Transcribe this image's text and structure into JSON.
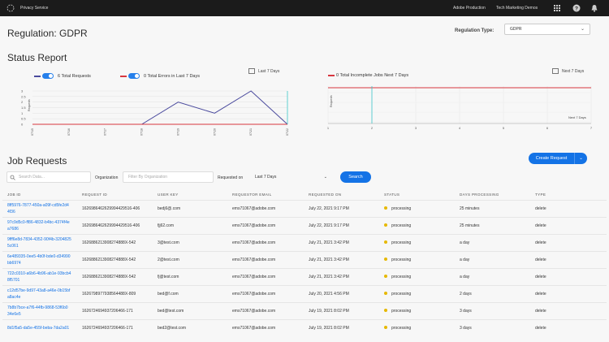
{
  "topbar": {
    "app_name": "Privacy Service",
    "org": "Adobe Production",
    "org_detail": "Tech Marketing Demos"
  },
  "header": {
    "title": "Regulation: GDPR",
    "regulation_label": "Regulation Type:",
    "regulation_value": "GDPR"
  },
  "status": {
    "title": "Status Report",
    "legend_requests": "6 Total Requests",
    "legend_errors": "0 Total Errors in Last 7 Days",
    "last7_label": "Last 7 Days",
    "incomplete_label": "0 Total Incomplete Jobs Next 7 Days",
    "next7_label": "Next 7 Days",
    "next7_axis_note": "Next 7 Days"
  },
  "chart_data": [
    {
      "type": "line",
      "title": "",
      "ylabel": "Requests",
      "ylim": [
        0,
        3
      ],
      "y_ticks": [
        "3",
        "2.5",
        "2",
        "1.5",
        "1",
        "0.5",
        "0"
      ],
      "x": [
        "07/15",
        "07/16",
        "07/17",
        "07/18",
        "07/19",
        "07/20",
        "07/21",
        "07/22"
      ],
      "series": [
        {
          "name": "6 Total Requests",
          "color": "#4b4b9e",
          "values": [
            0,
            0,
            0,
            0,
            2,
            1,
            3,
            0
          ]
        },
        {
          "name": "0 Total Errors in Last 7 Days",
          "color": "#d7373f",
          "values": [
            0,
            0,
            0,
            0,
            0,
            0,
            0,
            0
          ]
        }
      ],
      "grid": true
    },
    {
      "type": "line",
      "title": "",
      "ylabel": "Requests",
      "x": [
        "1",
        "2",
        "3",
        "4",
        "5",
        "6",
        "7"
      ],
      "series": [
        {
          "name": "0 Total Incomplete Jobs Next 7 Days",
          "color": "#d7373f",
          "values": [
            0,
            0,
            0,
            0,
            0,
            0,
            0
          ]
        }
      ],
      "grid": true
    }
  ],
  "jobs": {
    "title": "Job Requests",
    "create_label": "Create Request",
    "search_placeholder": "Search Data...",
    "org_label": "Organization",
    "org_placeholder": "Filter By Organization",
    "requested_on_label": "Requested on",
    "requested_on_value": "Last 7 Days",
    "search_button": "Search",
    "columns": [
      "JOB ID",
      "REQUEST ID",
      "USER KEY",
      "REQUESTOR EMAIL",
      "REQUESTED ON",
      "STATUS",
      "DAYS PROCESSING",
      "TYPE"
    ],
    "rows": [
      {
        "job_id": "8ff5976-7877-450a-a09f-cd5fe2d4 4f36",
        "request_id": "1626986462629994429516-406",
        "user_key": "bedj6@.com",
        "email": "ems71067@adobe.com",
        "requested_on": "July 22, 2021 9:17 PM",
        "status": "processing",
        "days": "25 minutes",
        "type": "delete"
      },
      {
        "job_id": "97c9d5c0-ff86-4832-b4bc-4374f4e a7686",
        "request_id": "1626986462629994429516-406",
        "user_key": "fjj62.com",
        "email": "ems71067@adobe.com",
        "requested_on": "July 22, 2021 9:17 PM",
        "status": "processing",
        "days": "25 minutes",
        "type": "delete"
      },
      {
        "job_id": "9fff6e8d-7834-4352-90f4b-3204825 5c061",
        "request_id": "1626886213908274888X-542",
        "user_key": "3@test.com",
        "email": "ems71067@adobe.com",
        "requested_on": "July 21, 2021 3:42 PM",
        "status": "processing",
        "days": "a day",
        "type": "delete"
      },
      {
        "job_id": "6e489335-0ee5-4b0f-bde0-d34990 bb6974",
        "request_id": "1626886213908274888X-542",
        "user_key": "2@test.com",
        "email": "ems71067@adobe.com",
        "requested_on": "July 21, 2021 3:42 PM",
        "status": "processing",
        "days": "a day",
        "type": "delete"
      },
      {
        "job_id": "722c0310-a6b6-4b96-ab1e-93bcb4 8f5701",
        "request_id": "1626886213908274888X-542",
        "user_key": "fj@test.com",
        "email": "ems71067@adobe.com",
        "requested_on": "July 21, 2021 3:42 PM",
        "status": "processing",
        "days": "a day",
        "type": "delete"
      },
      {
        "job_id": "c12d57be-9d97-43a8-a46e-0b15bf a8ac4e",
        "request_id": "1626798977938564488X-809",
        "user_key": "bed@f.com",
        "email": "ems71067@adobe.com",
        "requested_on": "July 20, 2021 4:56 PM",
        "status": "processing",
        "days": "2 days",
        "type": "delete"
      },
      {
        "job_id": "7b8b7bce-a7f6-44fb-9868-53f6b0 34e6e5",
        "request_id": "1626724694937206466-171",
        "user_key": "bed@test.com",
        "email": "ems71067@adobe.com",
        "requested_on": "July 19, 2021 8:02 PM",
        "status": "processing",
        "days": "3 days",
        "type": "delete"
      },
      {
        "job_id": "8d1f5a5-da5e-455f-beba-7da2a01",
        "request_id": "1626724694937206466-171",
        "user_key": "bed2@test.com",
        "email": "ems71067@adobe.com",
        "requested_on": "July 19, 2021 8:02 PM",
        "status": "processing",
        "days": "3 days",
        "type": "delete"
      }
    ]
  },
  "colors": {
    "accent": "#1473e6",
    "requests_line": "#4b4b9e",
    "errors_line": "#d7373f",
    "status_processing": "#e6b800",
    "topbar": "#1b1b1b"
  }
}
